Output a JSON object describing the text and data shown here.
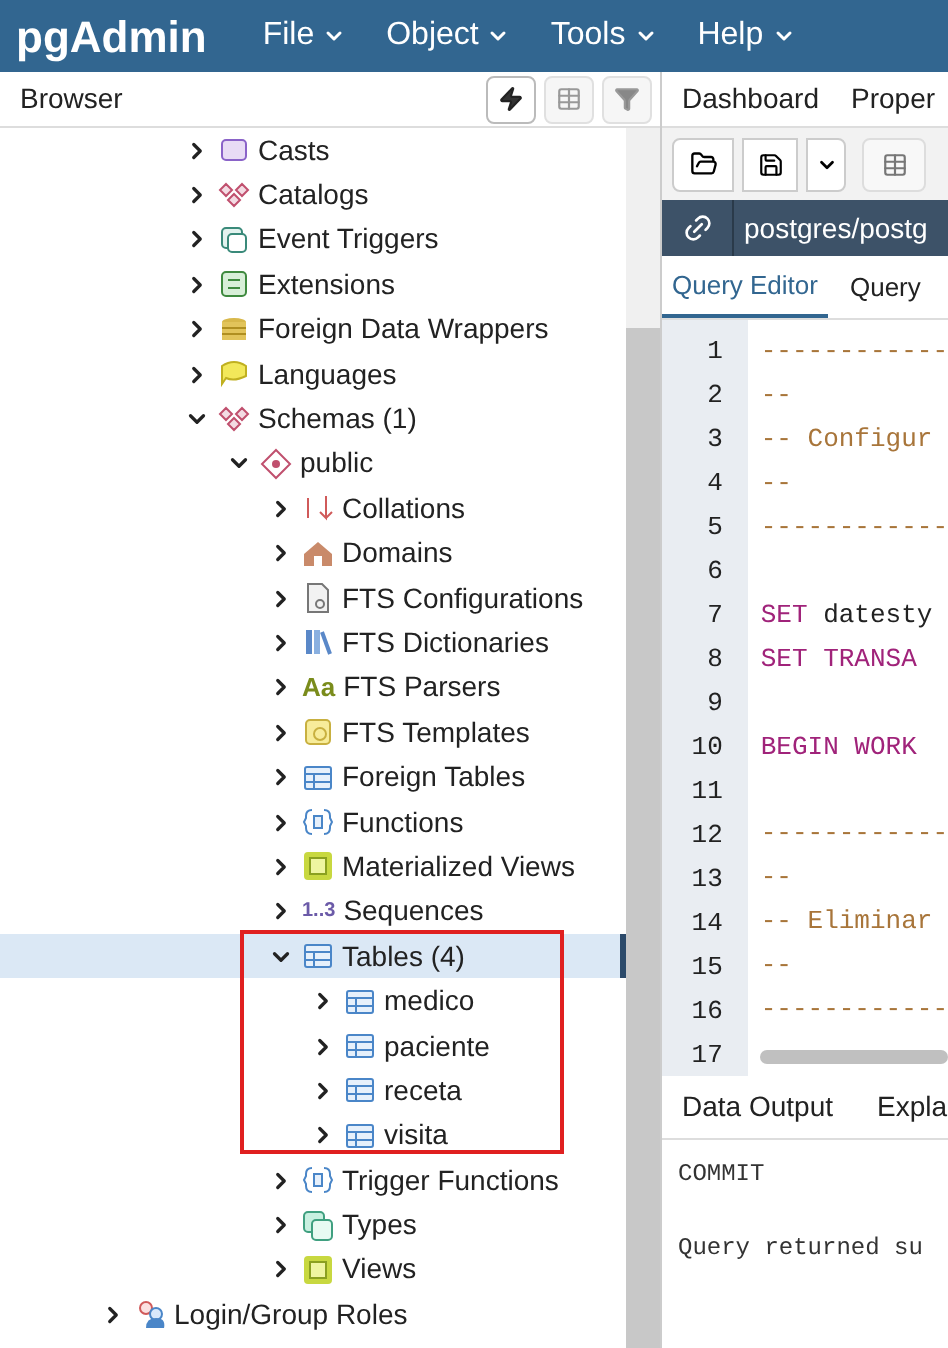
{
  "app": {
    "logo": "pgAdmin",
    "menus": [
      {
        "label": "File"
      },
      {
        "label": "Object"
      },
      {
        "label": "Tools"
      },
      {
        "label": "Help"
      }
    ]
  },
  "browser": {
    "title": "Browser",
    "tools": [
      {
        "kind": "query",
        "active": true
      },
      {
        "kind": "grid",
        "active": false
      },
      {
        "kind": "filter",
        "active": false
      }
    ],
    "tree": {
      "database_children": [
        {
          "label": "Casts",
          "kind": "casts",
          "expanded": false,
          "selected": false
        },
        {
          "label": "Catalogs",
          "kind": "catalogs",
          "expanded": false,
          "selected": false
        },
        {
          "label": "Event Triggers",
          "kind": "event-triggers",
          "expanded": false,
          "selected": false
        },
        {
          "label": "Extensions",
          "kind": "extensions",
          "expanded": false,
          "selected": false
        },
        {
          "label": "Foreign Data Wrappers",
          "kind": "fdw",
          "expanded": false,
          "selected": false
        },
        {
          "label": "Languages",
          "kind": "languages",
          "expanded": false,
          "selected": false
        },
        {
          "label": "Schemas (1)",
          "kind": "schemas",
          "expanded": true,
          "selected": false,
          "children": [
            {
              "label": "public",
              "kind": "schema",
              "expanded": true,
              "selected": false,
              "children": [
                {
                  "label": "Collations",
                  "kind": "collations",
                  "expanded": false,
                  "selected": false
                },
                {
                  "label": "Domains",
                  "kind": "domains",
                  "expanded": false,
                  "selected": false
                },
                {
                  "label": "FTS Configurations",
                  "kind": "fts-config",
                  "expanded": false,
                  "selected": false
                },
                {
                  "label": "FTS Dictionaries",
                  "kind": "fts-dict",
                  "expanded": false,
                  "selected": false
                },
                {
                  "label": "FTS Parsers",
                  "kind": "fts-parser",
                  "icon_text": "Aa",
                  "expanded": false,
                  "selected": false
                },
                {
                  "label": "FTS Templates",
                  "kind": "fts-template",
                  "expanded": false,
                  "selected": false
                },
                {
                  "label": "Foreign Tables",
                  "kind": "foreign-tables",
                  "expanded": false,
                  "selected": false
                },
                {
                  "label": "Functions",
                  "kind": "functions",
                  "expanded": false,
                  "selected": false
                },
                {
                  "label": "Materialized Views",
                  "kind": "mat-views",
                  "expanded": false,
                  "selected": false
                },
                {
                  "label": "Sequences",
                  "kind": "sequences",
                  "icon_text": "1..3",
                  "expanded": false,
                  "selected": false
                },
                {
                  "label": "Tables (4)",
                  "kind": "tables",
                  "expanded": true,
                  "selected": true,
                  "outlined": true,
                  "children": [
                    {
                      "label": "medico",
                      "kind": "table",
                      "expanded": false,
                      "selected": false
                    },
                    {
                      "label": "paciente",
                      "kind": "table",
                      "expanded": false,
                      "selected": false
                    },
                    {
                      "label": "receta",
                      "kind": "table",
                      "expanded": false,
                      "selected": false
                    },
                    {
                      "label": "visita",
                      "kind": "table",
                      "expanded": false,
                      "selected": false
                    }
                  ]
                },
                {
                  "label": "Trigger Functions",
                  "kind": "trigger-functions",
                  "expanded": false,
                  "selected": false
                },
                {
                  "label": "Types",
                  "kind": "types",
                  "expanded": false,
                  "selected": false
                },
                {
                  "label": "Views",
                  "kind": "views",
                  "expanded": false,
                  "selected": false
                }
              ]
            }
          ]
        }
      ],
      "server_children": [
        {
          "label": "Login/Group Roles",
          "kind": "roles",
          "expanded": false,
          "selected": false
        }
      ]
    }
  },
  "main_tabs": [
    {
      "label": "Dashboard",
      "selected": false
    },
    {
      "label": "Proper",
      "selected": false
    }
  ],
  "connection": "postgres/postg",
  "editor_tabs": [
    {
      "label": "Query Editor",
      "selected": true
    },
    {
      "label": "Query",
      "selected": false
    }
  ],
  "code_lines": [
    {
      "number": "1",
      "segments": [
        {
          "text": "------------",
          "kind": "comment"
        }
      ]
    },
    {
      "number": "2",
      "segments": [
        {
          "text": "--",
          "kind": "comment"
        }
      ]
    },
    {
      "number": "3",
      "segments": [
        {
          "text": "-- Configur",
          "kind": "comment"
        }
      ]
    },
    {
      "number": "4",
      "segments": [
        {
          "text": "--",
          "kind": "comment"
        }
      ]
    },
    {
      "number": "5",
      "segments": [
        {
          "text": "------------",
          "kind": "comment"
        }
      ]
    },
    {
      "number": "6"
    },
    {
      "number": "7",
      "segments": [
        {
          "text": "SET",
          "kind": "keyword"
        },
        {
          "text": " datesty",
          "kind": "plain"
        }
      ]
    },
    {
      "number": "8",
      "segments": [
        {
          "text": "SET TRANSA",
          "kind": "keyword"
        }
      ]
    },
    {
      "number": "9"
    },
    {
      "number": "10",
      "segments": [
        {
          "text": "BEGIN WORK",
          "kind": "keyword"
        }
      ]
    },
    {
      "number": "11"
    },
    {
      "number": "12",
      "segments": [
        {
          "text": "------------",
          "kind": "comment"
        }
      ]
    },
    {
      "number": "13",
      "segments": [
        {
          "text": "--",
          "kind": "comment"
        }
      ]
    },
    {
      "number": "14",
      "segments": [
        {
          "text": "-- Eliminar",
          "kind": "comment"
        }
      ]
    },
    {
      "number": "15",
      "segments": [
        {
          "text": "--",
          "kind": "comment"
        }
      ]
    },
    {
      "number": "16",
      "segments": [
        {
          "text": "------------",
          "kind": "comment"
        }
      ]
    },
    {
      "number": "17"
    }
  ],
  "output_tabs": [
    {
      "label": "Data Output",
      "selected": false
    },
    {
      "label": "Expla",
      "selected": false
    }
  ],
  "output_lines": [
    "COMMIT",
    "Query returned su"
  ]
}
